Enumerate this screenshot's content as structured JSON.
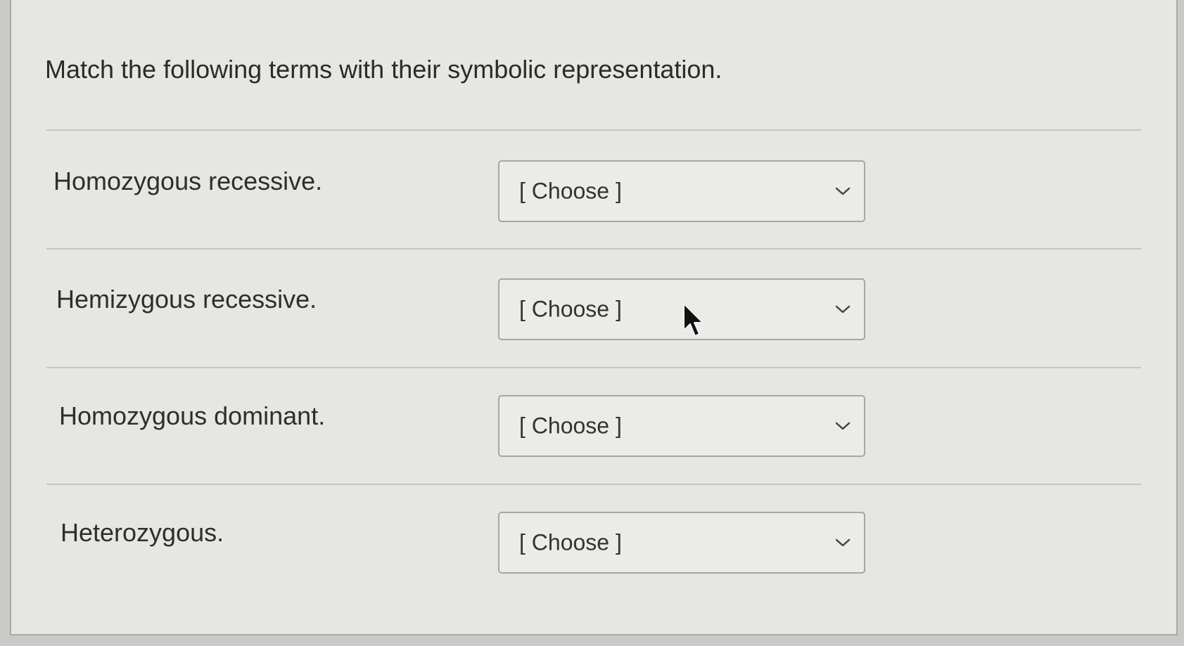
{
  "question": {
    "title": "Match the following terms with their symbolic representation."
  },
  "rows": [
    {
      "term": "Homozygous recessive.",
      "selected": "[ Choose ]"
    },
    {
      "term": "Hemizygous recessive.",
      "selected": "[ Choose ]"
    },
    {
      "term": "Homozygous dominant.",
      "selected": "[ Choose ]"
    },
    {
      "term": "Heterozygous.",
      "selected": "[ Choose ]"
    }
  ],
  "icons": {
    "dropdown": "chevron-down-icon",
    "pointer": "mouse-cursor-icon"
  },
  "colors": {
    "page_background": "#e6e6e3",
    "text": "#2e2e2e",
    "select_border": "#a6a6a3",
    "divider": "#c4c4c1"
  }
}
